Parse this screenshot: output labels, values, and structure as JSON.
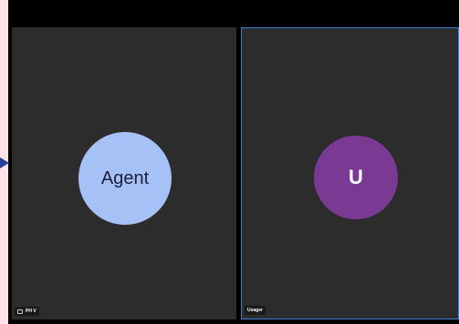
{
  "participants": [
    {
      "name": "PH V",
      "avatar_label": "Agent",
      "avatar_color": "#a6c1f6"
    },
    {
      "name": "Usager",
      "avatar_label": "U",
      "avatar_color": "#7a3a93"
    }
  ],
  "active_speaker_border_color": "#3d7fd6",
  "icons": {
    "nametag_icon": "mic-muted-icon",
    "pointer": "arrow-right-icon"
  }
}
